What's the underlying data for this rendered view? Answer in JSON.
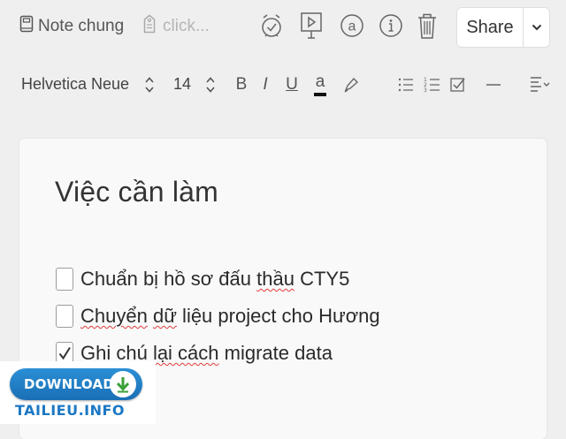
{
  "toolbar": {
    "notebook_name": "Note chung",
    "tag_placeholder": "click...",
    "share_label": "Share",
    "icons": [
      "notebook-icon",
      "tag-icon",
      "reminder-icon",
      "presentation-icon",
      "at-icon",
      "info-icon",
      "trash-icon",
      "chevron-down-icon"
    ]
  },
  "format_bar": {
    "font_family": "Helvetica Neue",
    "font_size": "14",
    "bold": "B",
    "italic": "I",
    "underline": "U",
    "text_color": "a",
    "icons": [
      "highlighter-icon",
      "bullet-list-icon",
      "numbered-list-icon",
      "checkbox-icon",
      "horizontal-rule-icon",
      "align-icon"
    ]
  },
  "note": {
    "title": "Việc cần làm",
    "todos": [
      {
        "text": "Chuẩn bị hồ sơ đấu thầu CTY5",
        "checked": false
      },
      {
        "text": "Chuyển dữ liệu project cho Hương",
        "checked": false
      },
      {
        "text": "Ghi chú lại cách migrate data",
        "checked": true
      }
    ]
  },
  "watermark": {
    "download_label": "DOWNLOAD",
    "site": "TAILIEU.INFO"
  },
  "colors": {
    "background": "#efefef",
    "note_background": "#f9f9f9",
    "spellcheck": "#e23b3b",
    "badge_blue": "#1c78c4"
  }
}
